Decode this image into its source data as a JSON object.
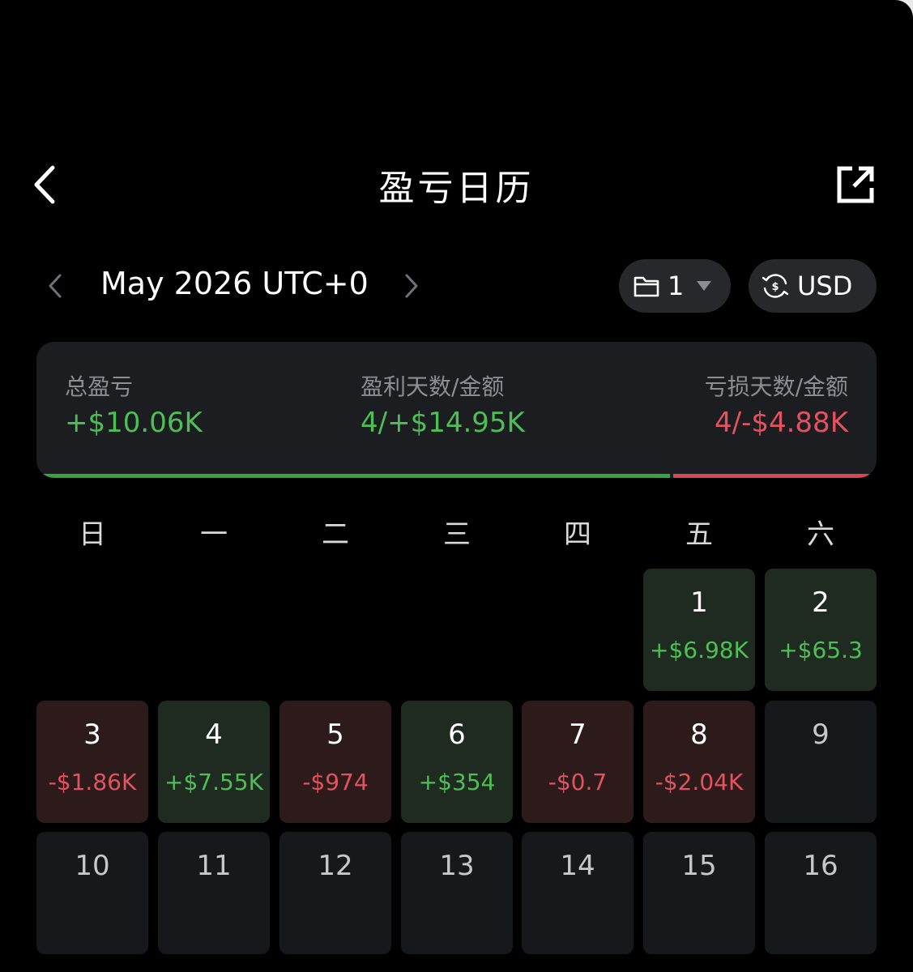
{
  "header": {
    "title": "盈亏日历"
  },
  "month": {
    "label": "May 2026 UTC+0"
  },
  "filters": {
    "account_count": "1",
    "currency": "USD"
  },
  "summary": {
    "total_label": "总盈亏",
    "total_value": "+$10.06K",
    "profit_label": "盈利天数/金额",
    "profit_value": "4/+$14.95K",
    "loss_label": "亏损天数/金额",
    "loss_value": "4/-$4.88K",
    "profit_share": 0.754
  },
  "weekdays": [
    "日",
    "一",
    "二",
    "三",
    "四",
    "五",
    "六"
  ],
  "colors": {
    "profit": "#4cbf55",
    "loss": "#e2535f"
  },
  "days": [
    {
      "day": "1",
      "pnl": "+$6.98K",
      "status": "pos"
    },
    {
      "day": "2",
      "pnl": "+$65.3",
      "status": "pos"
    },
    {
      "day": "3",
      "pnl": "-$1.86K",
      "status": "neg"
    },
    {
      "day": "4",
      "pnl": "+$7.55K",
      "status": "pos"
    },
    {
      "day": "5",
      "pnl": "-$974",
      "status": "neg"
    },
    {
      "day": "6",
      "pnl": "+$354",
      "status": "pos"
    },
    {
      "day": "7",
      "pnl": "-$0.7",
      "status": "neg"
    },
    {
      "day": "8",
      "pnl": "-$2.04K",
      "status": "neg"
    },
    {
      "day": "9",
      "pnl": "",
      "status": "empty"
    },
    {
      "day": "10",
      "pnl": "",
      "status": "empty"
    },
    {
      "day": "11",
      "pnl": "",
      "status": "empty"
    },
    {
      "day": "12",
      "pnl": "",
      "status": "empty"
    },
    {
      "day": "13",
      "pnl": "",
      "status": "empty"
    },
    {
      "day": "14",
      "pnl": "",
      "status": "empty"
    },
    {
      "day": "15",
      "pnl": "",
      "status": "empty"
    },
    {
      "day": "16",
      "pnl": "",
      "status": "empty"
    }
  ]
}
